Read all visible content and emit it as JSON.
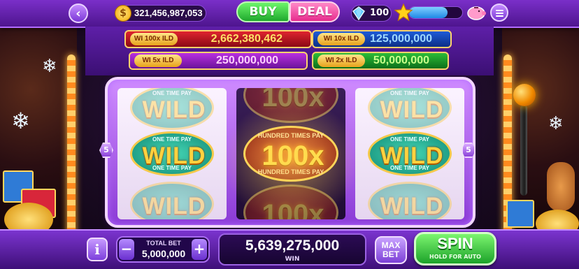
{
  "header": {
    "coin_balance": "321,456,987,053",
    "buy_label": "BUY",
    "deal_label": "DEAL",
    "gem_count": "100",
    "xp_progress": 0.72
  },
  "jackpots": [
    {
      "badge": "WI 100x ILD",
      "value": "2,662,380,462",
      "color": "#e0242f"
    },
    {
      "badge": "WI 10x ILD",
      "value": "125,000,000",
      "color": "#1e5bd8"
    },
    {
      "badge": "WI 5x ILD",
      "value": "250,000,000",
      "color": "#b92fe0"
    },
    {
      "badge": "WI 2x ILD",
      "value": "50,000,000",
      "color": "#2dbd38"
    }
  ],
  "reels": {
    "wild_text": "WILD",
    "wild_caption": "ONE TIME PAY",
    "hundred_text": "100x",
    "hundred_caption": "HUNDRED TIMES PAY",
    "line_number": "5"
  },
  "footer": {
    "total_bet_label": "TOTAL BET",
    "total_bet_value": "5,000,000",
    "win_value": "5,639,275,000",
    "win_label": "WIN",
    "max_bet_line1": "MAX",
    "max_bet_line2": "BET",
    "spin_label": "SPIN",
    "spin_sub": "HOLD FOR AUTO",
    "minus": "−",
    "plus": "+",
    "info": "i"
  },
  "icons": {
    "back": "back-arrow-icon",
    "coin": "coin-icon",
    "gem": "gem-icon",
    "star": "star-icon",
    "piggy": "piggy-bank-icon",
    "menu": "menu-icon"
  }
}
